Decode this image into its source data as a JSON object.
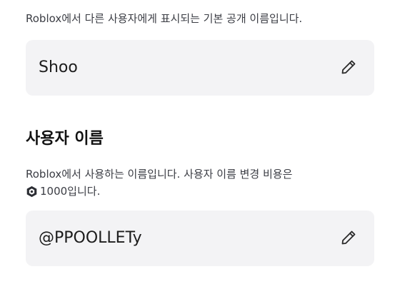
{
  "display_name": {
    "description": "Roblox에서 다른 사용자에게 표시되는 기본 공개 이름입니다.",
    "value": "Shoo",
    "edit_icon": "pencil-icon"
  },
  "username": {
    "title": "사용자 이름",
    "description_line1": "Roblox에서 사용하는 이름입니다. 사용자 이름 변경 비용은",
    "cost_icon": "robux-icon",
    "cost_text": "1000입니다.",
    "value": "@PPOOLLETy",
    "edit_icon": "pencil-icon"
  }
}
